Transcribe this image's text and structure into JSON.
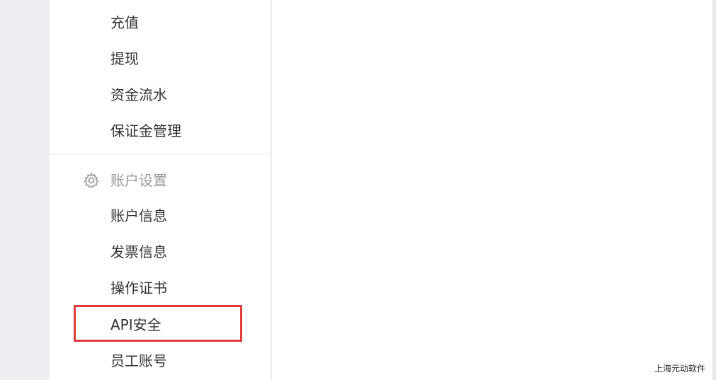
{
  "sidebar": {
    "finance_items": [
      {
        "label": "充值"
      },
      {
        "label": "提现"
      },
      {
        "label": "资金流水"
      },
      {
        "label": "保证金管理"
      }
    ],
    "account_section": {
      "label": "账户设置",
      "icon": "gear-icon"
    },
    "account_items": [
      {
        "label": "账户信息"
      },
      {
        "label": "发票信息"
      },
      {
        "label": "操作证书"
      },
      {
        "label": "API安全",
        "highlighted": true
      },
      {
        "label": "员工账号"
      }
    ]
  },
  "colors": {
    "highlight_border": "#e03c3c",
    "section_label": "#9a9a9a",
    "text": "#333333"
  },
  "watermark": "上海元动软件"
}
